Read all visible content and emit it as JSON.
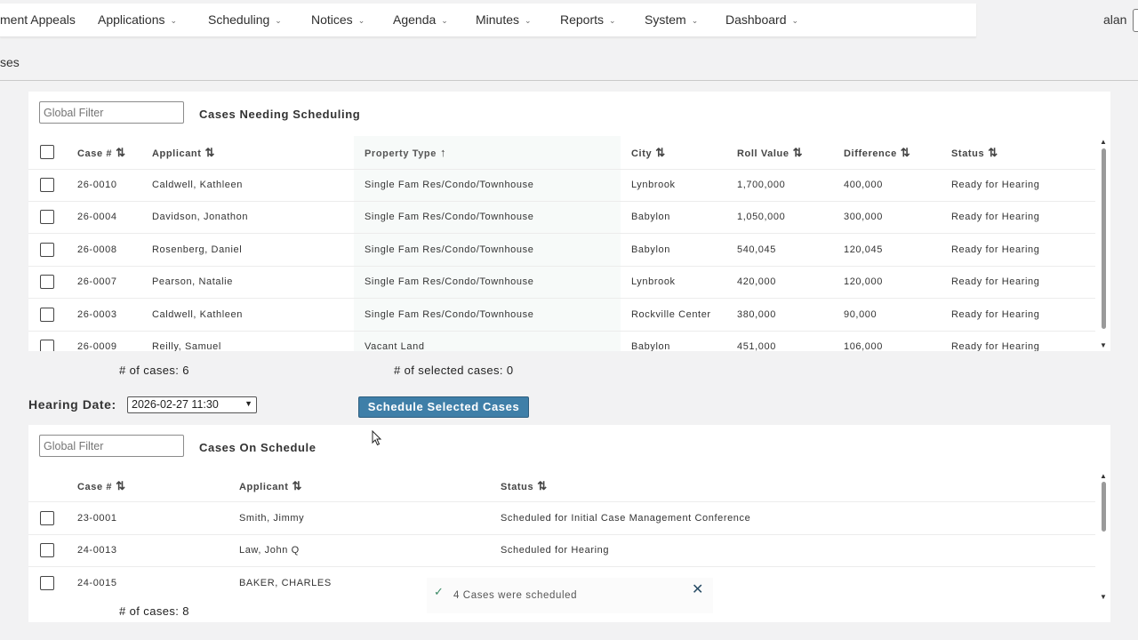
{
  "nav": {
    "items": [
      {
        "label": "ment Appeals",
        "chevron": false
      },
      {
        "label": "Applications",
        "chevron": true
      },
      {
        "label": "Scheduling",
        "chevron": true
      },
      {
        "label": "Notices",
        "chevron": true
      },
      {
        "label": "Agenda",
        "chevron": true
      },
      {
        "label": "Minutes",
        "chevron": true
      },
      {
        "label": "Reports",
        "chevron": true
      },
      {
        "label": "System",
        "chevron": true
      },
      {
        "label": "Dashboard",
        "chevron": true
      }
    ],
    "user": "alan"
  },
  "breadcrumb": "ses",
  "needing": {
    "filter_placeholder": "Global Filter",
    "title": "Cases Needing Scheduling",
    "columns": [
      "Case #",
      "Applicant",
      "Property Type",
      "City",
      "Roll Value",
      "Difference",
      "Status"
    ],
    "rows": [
      [
        "26-0010",
        "Caldwell, Kathleen",
        "Single Fam Res/Condo/Townhouse",
        "Lynbrook",
        "1,700,000",
        "400,000",
        "Ready for Hearing"
      ],
      [
        "26-0004",
        "Davidson, Jonathon",
        "Single Fam Res/Condo/Townhouse",
        "Babylon",
        "1,050,000",
        "300,000",
        "Ready for Hearing"
      ],
      [
        "26-0008",
        "Rosenberg, Daniel",
        "Single Fam Res/Condo/Townhouse",
        "Babylon",
        "540,045",
        "120,045",
        "Ready for Hearing"
      ],
      [
        "26-0007",
        "Pearson, Natalie",
        "Single Fam Res/Condo/Townhouse",
        "Lynbrook",
        "420,000",
        "120,000",
        "Ready for Hearing"
      ],
      [
        "26-0003",
        "Caldwell, Kathleen",
        "Single Fam Res/Condo/Townhouse",
        "Rockville Center",
        "380,000",
        "90,000",
        "Ready for Hearing"
      ],
      [
        "26-0009",
        "Reilly, Samuel",
        "Vacant Land",
        "Babylon",
        "451,000",
        "106,000",
        "Ready for Hearing"
      ]
    ],
    "count_label": "# of cases: 6",
    "selected_label": "# of selected cases: 0"
  },
  "hearing": {
    "label": "Hearing Date:",
    "value": "2026-02-27 11:30",
    "button": "Schedule Selected Cases"
  },
  "on_schedule": {
    "filter_placeholder": "Global Filter",
    "title": "Cases On Schedule",
    "columns": [
      "Case #",
      "Applicant",
      "Status"
    ],
    "rows": [
      [
        "23-0001",
        "Smith, Jimmy",
        "Scheduled for Initial Case Management Conference"
      ],
      [
        "24-0013",
        "Law, John Q",
        "Scheduled for Hearing"
      ],
      [
        "24-0015",
        "BAKER, CHARLES",
        ""
      ]
    ],
    "count_label": "# of cases: 8"
  },
  "toast": {
    "message": "4 Cases were scheduled",
    "icon": "check-icon",
    "close_icon": "close-icon"
  },
  "colors": {
    "button": "#3f7fa8",
    "toast_check": "#3c8a66"
  }
}
